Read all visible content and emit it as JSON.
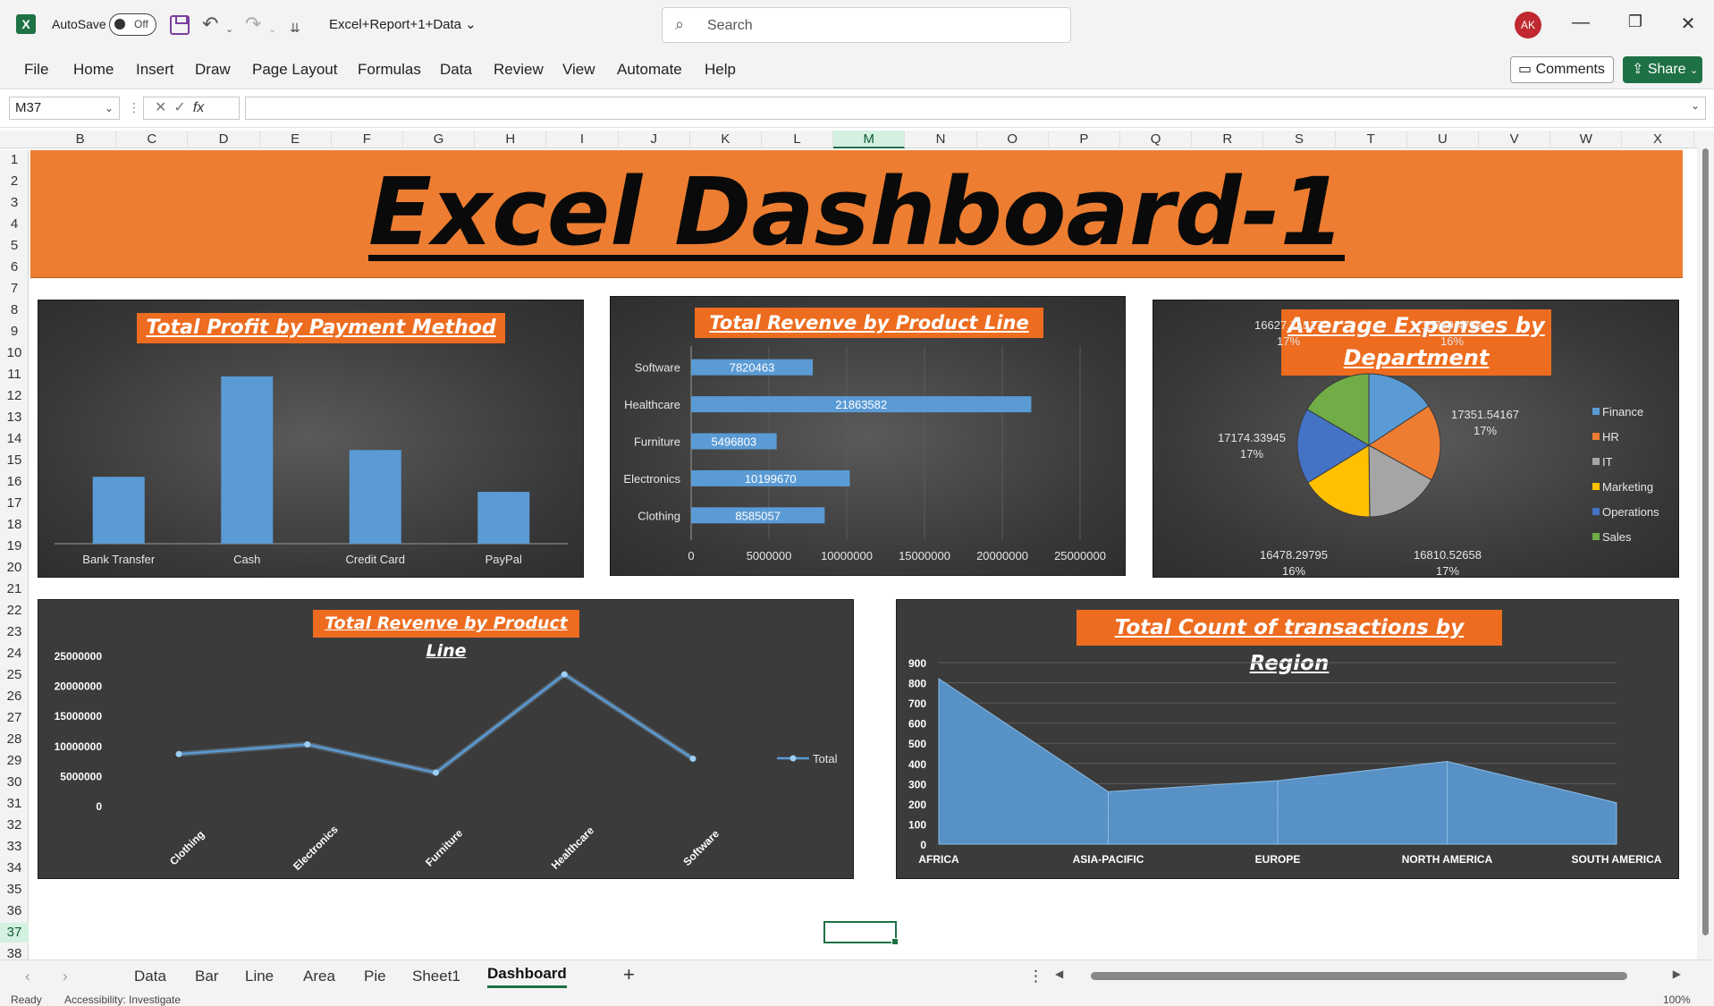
{
  "app": {
    "autosave_label": "AutoSave",
    "autosave_state": "Off",
    "doc_title": "Excel+Report+1+Data",
    "search_placeholder": "Search",
    "user_initials": "AK"
  },
  "ribbon": {
    "tabs": [
      "File",
      "Home",
      "Insert",
      "Draw",
      "Page Layout",
      "Formulas",
      "Data",
      "Review",
      "View",
      "Automate",
      "Help"
    ],
    "comments_label": "Comments",
    "share_label": "Share"
  },
  "formula_bar": {
    "cell_ref": "M37",
    "fx_label": "fx",
    "formula": ""
  },
  "grid": {
    "columns": [
      "B",
      "C",
      "D",
      "E",
      "F",
      "G",
      "H",
      "I",
      "J",
      "K",
      "L",
      "M",
      "N",
      "O",
      "P",
      "Q",
      "R",
      "S",
      "T",
      "U",
      "V",
      "W",
      "X"
    ],
    "active_column": "M",
    "rows": [
      "1",
      "2",
      "3",
      "4",
      "5",
      "6",
      "7",
      "8",
      "9",
      "10",
      "11",
      "12",
      "13",
      "14",
      "15",
      "16",
      "17",
      "18",
      "19",
      "20",
      "21",
      "22",
      "23",
      "24",
      "25",
      "26",
      "27",
      "28",
      "29",
      "30",
      "31",
      "32",
      "33",
      "34",
      "35",
      "36",
      "37",
      "38"
    ],
    "active_row": "37"
  },
  "dashboard": {
    "banner_title": "Excel Dashboard-1"
  },
  "colors": {
    "excel_green": "#1e7145",
    "banner_orange": "#ed7d31",
    "chart_blue": "#5b9bd5",
    "finance": "#5b9bd5",
    "hr": "#ed7d31",
    "it": "#a5a5a5",
    "marketing": "#ffc000",
    "operations": "#4472c4",
    "sales": "#70ad47"
  },
  "chart_data": [
    {
      "type": "bar",
      "title": "Total Profit by Payment Method",
      "categories": [
        "Bank Transfer",
        "Cash",
        "Credit Card",
        "PayPal"
      ],
      "values": [
        40,
        100,
        56,
        31
      ],
      "ylim": [
        0,
        100
      ],
      "grid": false
    },
    {
      "type": "bar",
      "orientation": "horizontal",
      "title": "Total Revenve by Product Line",
      "categories": [
        "Software",
        "Healthcare",
        "Furniture",
        "Electronics",
        "Clothing"
      ],
      "values": [
        7820463,
        21863582,
        5496803,
        10199670,
        8585057
      ],
      "x_ticks": [
        "0",
        "5000000",
        "10000000",
        "15000000",
        "20000000",
        "25000000"
      ],
      "xlim": [
        0,
        25000000
      ],
      "grid": true
    },
    {
      "type": "pie",
      "title": "Average Expenses by Department",
      "slices": [
        {
          "name": "Finance",
          "value": 15749.4759,
          "value_label": "15749.4759",
          "pct": "16%"
        },
        {
          "name": "HR",
          "value": 17351.54167,
          "value_label": "17351.54167",
          "pct": "17%"
        },
        {
          "name": "IT",
          "value": 16810.52658,
          "value_label": "16810.52658",
          "pct": "17%"
        },
        {
          "name": "Marketing",
          "value": 16478.29795,
          "value_label": "16478.29795",
          "pct": "16%"
        },
        {
          "name": "Operations",
          "value": 17174.33945,
          "value_label": "17174.33945",
          "pct": "17%"
        },
        {
          "name": "Sales",
          "value": 16627.71517,
          "value_label": "16627.71517",
          "pct": "17%"
        }
      ],
      "legend": "right"
    },
    {
      "type": "line",
      "title": "Total Revenve by Product Line",
      "categories": [
        "Clothing",
        "Electronics",
        "Furniture",
        "Healthcare",
        "Software"
      ],
      "series": [
        {
          "name": "Total",
          "values": [
            8585057,
            10199670,
            5496803,
            21863582,
            7820463
          ]
        }
      ],
      "y_ticks": [
        "25000000",
        "20000000",
        "15000000",
        "10000000",
        "5000000",
        "0"
      ],
      "ylim": [
        0,
        25000000
      ],
      "legend": "right"
    },
    {
      "type": "area",
      "title": "Total Count of transactions by Region",
      "categories": [
        "AFRICA",
        "ASIA-PACIFIC",
        "EUROPE",
        "NORTH AMERICA",
        "SOUTH AMERICA"
      ],
      "values": [
        820,
        260,
        315,
        410,
        205
      ],
      "y_ticks": [
        "900",
        "800",
        "700",
        "600",
        "500",
        "400",
        "300",
        "200",
        "100",
        "0"
      ],
      "ylim": [
        0,
        900
      ],
      "grid": true
    }
  ],
  "sheets": {
    "tabs": [
      "Data",
      "Bar",
      "Line",
      "Area",
      "Pie",
      "Sheet1",
      "Dashboard"
    ],
    "active": "Dashboard",
    "add_label": "+"
  },
  "status": {
    "ready": "Ready",
    "accessibility": "Accessibility: Investigate",
    "zoom": "100%"
  }
}
